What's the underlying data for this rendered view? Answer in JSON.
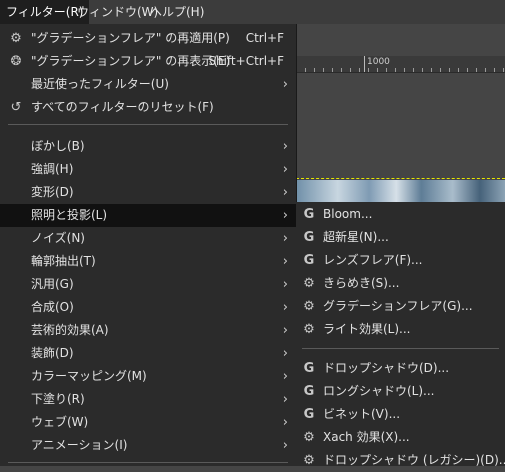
{
  "menubar": {
    "items": [
      {
        "label": "フィルター(R)"
      },
      {
        "label": "ウィンドウ(W)"
      },
      {
        "label": "ヘルプ(H)"
      }
    ]
  },
  "ruler": {
    "label": "1000"
  },
  "filters_menu": {
    "top_items": [
      {
        "icon": "gear-icon",
        "label": "\"グラデーションフレア\" の再適用(P)",
        "shortcut": "Ctrl+F"
      },
      {
        "icon": "gear-refresh-icon",
        "label": "\"グラデーションフレア\" の再表示(E)",
        "shortcut": "Shift+Ctrl+F"
      },
      {
        "icon": "",
        "label": "最近使ったフィルター(U)",
        "submenu": true
      },
      {
        "icon": "reset-icon",
        "label": "すべてのフィルターのリセット(F)"
      }
    ],
    "category_items": [
      {
        "label": "ぼかし(B)"
      },
      {
        "label": "強調(H)"
      },
      {
        "label": "変形(D)"
      },
      {
        "label": "照明と投影(L)",
        "active": true
      },
      {
        "label": "ノイズ(N)"
      },
      {
        "label": "輪郭抽出(T)"
      },
      {
        "label": "汎用(G)"
      },
      {
        "label": "合成(O)"
      },
      {
        "label": "芸術的効果(A)"
      },
      {
        "label": "装飾(D)"
      },
      {
        "label": "カラーマッピング(M)"
      },
      {
        "label": "下塗り(R)"
      },
      {
        "label": "ウェブ(W)"
      },
      {
        "label": "アニメーション(I)"
      }
    ]
  },
  "light_shadow_submenu": {
    "group1": [
      {
        "icon": "gegl-icon",
        "label": "Bloom..."
      },
      {
        "icon": "gegl-icon",
        "label": "超新星(N)..."
      },
      {
        "icon": "gegl-icon",
        "label": "レンズフレア(F)..."
      },
      {
        "icon": "gear-icon",
        "label": "きらめき(S)..."
      },
      {
        "icon": "gear-icon",
        "label": "グラデーションフレア(G)..."
      },
      {
        "icon": "gear-icon",
        "label": "ライト効果(L)..."
      }
    ],
    "group2": [
      {
        "icon": "gegl-icon",
        "label": "ドロップシャドウ(D)..."
      },
      {
        "icon": "gegl-icon",
        "label": "ロングシャドウ(L)..."
      },
      {
        "icon": "gegl-icon",
        "label": "ビネット(V)..."
      },
      {
        "icon": "gear-icon",
        "label": "Xach 効果(X)..."
      },
      {
        "icon": "gear-icon",
        "label": "ドロップシャドウ (レガシー)(D)..."
      }
    ]
  }
}
